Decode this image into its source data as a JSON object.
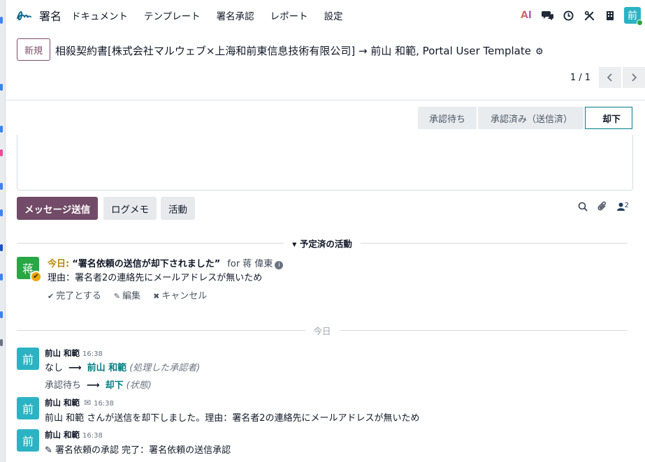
{
  "nav": {
    "brand": "署名",
    "menu": [
      "ドキュメント",
      "テンプレート",
      "署名承認",
      "レポート",
      "設定"
    ],
    "ai_label": "AI",
    "avatar_initial": "前"
  },
  "control": {
    "new_label": "新規",
    "title": "相殺契約書[株式会社マルウェブ×上海和前東信息技術有限公司] → 前山 和範, Portal User Template",
    "pager_value": "1 / 1"
  },
  "statusbar": {
    "stages": [
      "承認待ち",
      "承認済み（送信済）",
      "却下"
    ],
    "active": "却下"
  },
  "chatter": {
    "send_message": "メッセージ送信",
    "log_note": "ログメモ",
    "activity": "活動",
    "followers_count": "2"
  },
  "planned": {
    "separator": "予定済の活動",
    "avatar_initial": "蒋",
    "today": "今日:",
    "summary": "“署名依頼の送信が却下されました”",
    "for_text": "for 蒋 偉東",
    "note": "理由：署名者2の連絡先にメールアドレスが無いため",
    "actions": [
      "完了とする",
      "編集",
      "キャンセル"
    ]
  },
  "today_separator": "今日",
  "messages": [
    {
      "initial": "前",
      "author": "前山 和範",
      "time": "16:38",
      "line1_from": "なし",
      "line1_to": "前山 和範",
      "line1_field": "(処理した承認者)",
      "line2_from": "承認待ち",
      "line2_to": "却下",
      "line2_field": "(状態)"
    },
    {
      "initial": "前",
      "author": "前山 和範",
      "time": "16:38",
      "body": "前山 和範 さんが送信を却下しました。理由：署名者2の連絡先にメールアドレスが無いため"
    },
    {
      "initial": "前",
      "author": "前山 和範",
      "time": "16:38",
      "body": "署名依頼の承認 完了：署名依頼の送信承認"
    }
  ],
  "colors": {
    "primary": "#714b67",
    "teal": "#017e84",
    "avatar": "#2bb3c3",
    "activity_avatar": "#28a745",
    "today": "#b8860b"
  }
}
